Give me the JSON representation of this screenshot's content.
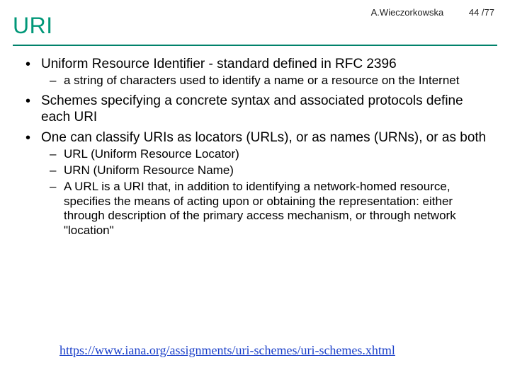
{
  "meta": {
    "author": "A.Wieczorkowska",
    "page": "44 /77"
  },
  "title": "URI",
  "bullets": [
    {
      "text": "Uniform Resource Identifier - standard defined in RFC 2396",
      "sub": [
        "a string of characters used to identify a name or a resource on the Internet"
      ]
    },
    {
      "text": "Schemes specifying a concrete syntax and associated protocols define each URI",
      "sub": []
    },
    {
      "text": "One can classify URIs as locators (URLs), or as names (URNs), or as both",
      "sub": [
        "URL (Uniform Resource Locator)",
        "URN (Uniform Resource Name)",
        "A URL is a URI that, in addition to identifying a network-homed resource, specifies the means of acting upon or obtaining the representation: either through description of the primary access mechanism, or through network \"location\""
      ]
    }
  ],
  "link": "https://www.iana.org/assignments/uri-schemes/uri-schemes.xhtml"
}
